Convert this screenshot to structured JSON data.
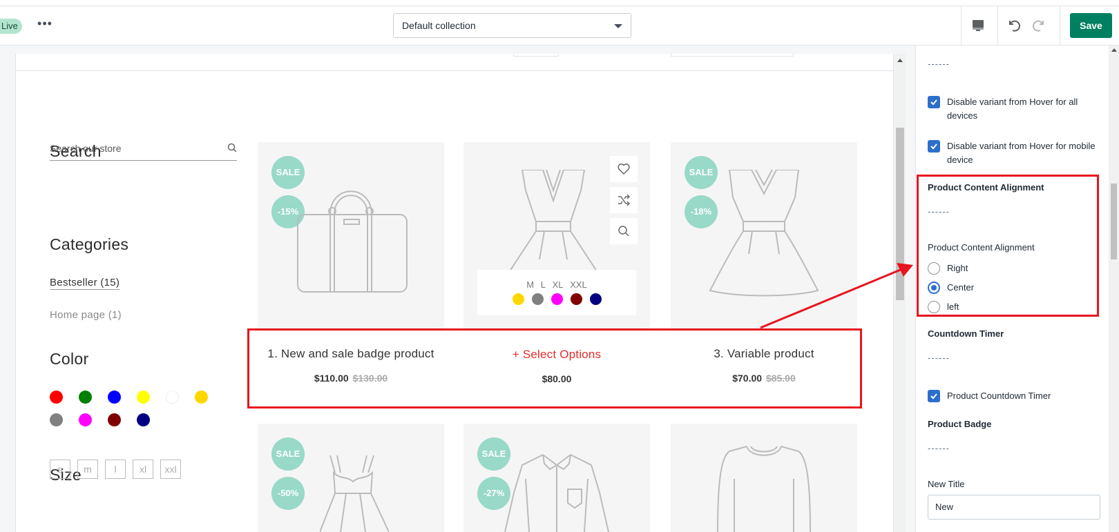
{
  "topbar": {
    "live_label": "Live",
    "more_label": "•••",
    "collection_selected": "Default collection",
    "save_label": "Save"
  },
  "sidebar": {
    "search_heading": "Search",
    "search_placeholder": "Search our store",
    "categories_heading": "Categories",
    "categories": [
      {
        "label": "Bestseller (15)"
      },
      {
        "label": "Home page (1)"
      }
    ],
    "color_heading": "Color",
    "colors": [
      "#ff0000",
      "#008000",
      "#0000ff",
      "#ffff00",
      "#ffffff",
      "#ffd700",
      "#808080",
      "#ff00ff",
      "#800000",
      "#000080"
    ],
    "size_heading": "Size",
    "sizes": [
      "s",
      "m",
      "l",
      "xl",
      "xxl"
    ]
  },
  "products": [
    {
      "title": "1. New and sale badge product",
      "price": "$110.00",
      "old_price": "$130.00",
      "badges": [
        "SALE",
        "-15%"
      ]
    },
    {
      "title": "+ Select Options",
      "price": "$80.00",
      "old_price": "",
      "badges": [],
      "variant_sizes": [
        "M",
        "L",
        "XL",
        "XXL"
      ],
      "variant_colors": [
        "#ffd700",
        "#808080",
        "#ff00ff",
        "#800000",
        "#000080"
      ]
    },
    {
      "title": "3. Variable product",
      "price": "$70.00",
      "old_price": "$85.00",
      "badges": [
        "SALE",
        "-18%"
      ]
    },
    {
      "badges": [
        "SALE",
        "-50%"
      ]
    },
    {
      "badges": [
        "SALE",
        "-27%"
      ]
    },
    {
      "badges": []
    }
  ],
  "settings": {
    "dash": "------",
    "checkboxes": [
      {
        "label": "Disable variant from Hover for all devices"
      },
      {
        "label": "Disable variant from Hover for mobile device"
      }
    ],
    "alignment_heading": "Product Content Alignment",
    "alignment_label": "Product Content Alignment",
    "alignment_options": [
      {
        "label": "Right",
        "checked": false
      },
      {
        "label": "Center",
        "checked": true
      },
      {
        "label": "left",
        "checked": false
      }
    ],
    "countdown_heading": "Countdown Timer",
    "countdown_checkbox": "Product Countdown Timer",
    "badge_heading": "Product Badge",
    "new_title_label": "New Title",
    "new_title_value": "New"
  },
  "colors": {
    "accent": "#008060",
    "highlight": "#e8141f",
    "badge": "#98d9c8",
    "checkbox": "#2c6ecb"
  }
}
